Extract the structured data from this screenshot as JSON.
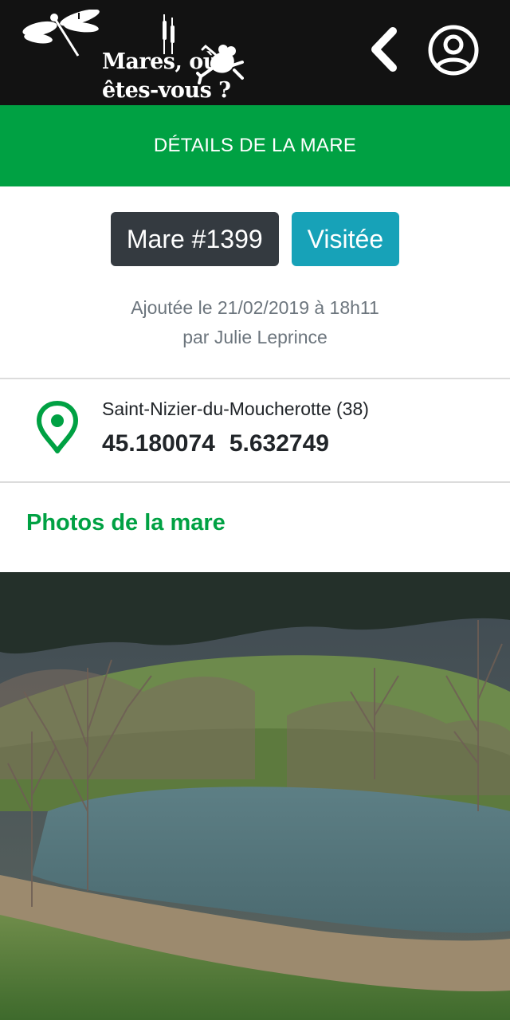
{
  "header": {
    "logo_line1": "Mares, où",
    "logo_line2": "êtes-vous ?",
    "back_icon": "chevron-left-icon",
    "account_icon": "user-circle-icon"
  },
  "page": {
    "section_title": "DÉTAILS DE LA MARE"
  },
  "mare": {
    "id_label": "Mare #1399",
    "status_label": "Visitée",
    "added_line1": "Ajoutée le 21/02/2019 à 18h11",
    "added_line2": "par Julie Leprince",
    "commune": "Saint-Nizier-du-Moucherotte (38)",
    "latitude": "45.180074",
    "longitude": "5.632749"
  },
  "photos": {
    "title": "Photos de la mare"
  },
  "colors": {
    "header_bg": "#121212",
    "brand_green": "#00a143",
    "badge_dark": "#343a40",
    "badge_info": "#17a2b8",
    "muted_text": "#6c757d"
  }
}
